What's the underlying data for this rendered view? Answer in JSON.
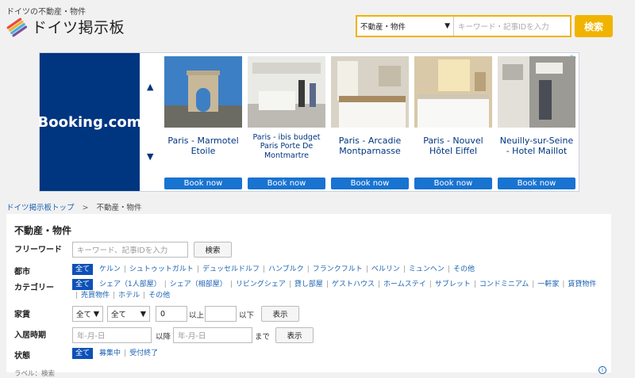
{
  "header": {
    "tagline": "ドイツの不動産・物件",
    "title": "ドイツ掲示板",
    "search": {
      "category": "不動産・物件",
      "placeholder": "キーワード・記事IDを入力",
      "button": "検索"
    }
  },
  "ad": {
    "brand": "Booking",
    "brand_suffix": ".com",
    "book_label": "Book now",
    "hotels": [
      {
        "name": "Paris - Marmotel Etoile"
      },
      {
        "name": "Paris - ibis budget Paris Porte De Montmartre"
      },
      {
        "name": "Paris - Arcadie Montparnasse"
      },
      {
        "name": "Paris - Nouvel Hôtel Eiffel"
      },
      {
        "name": "Neuilly-sur-Seine - Hotel Maillot"
      }
    ]
  },
  "breadcrumb": {
    "home": "ドイツ掲示板トップ",
    "separator": ">",
    "current": "不動産・物件"
  },
  "filters": {
    "title": "不動産・物件",
    "freeword": {
      "label": "フリーワード",
      "placeholder": "キーワード、記事IDを入力",
      "button": "検索"
    },
    "city": {
      "label": "都市",
      "options": [
        "全て",
        "ケルン",
        "シュトゥットガルト",
        "デュッセルドルフ",
        "ハンブルク",
        "フランクフルト",
        "ベルリン",
        "ミュンヘン",
        "その他"
      ]
    },
    "category": {
      "label": "カテゴリー",
      "options": [
        "全て",
        "シェア（1人部屋）",
        "シェア（相部屋）",
        "リビングシェア",
        "貸し部屋",
        "ゲストハウス",
        "ホームステイ",
        "サブレット",
        "コンドミニアム",
        "一軒家",
        "賃貸物件",
        "売買物件",
        "ホテル",
        "その他"
      ]
    },
    "rent": {
      "label": "家賃",
      "select1": "全て",
      "select2": "全て",
      "min_value": "0",
      "min_suffix": "以上",
      "max_suffix": "以下",
      "button": "表示"
    },
    "move_in": {
      "label": "入居時期",
      "from_placeholder": "年-月-日",
      "from_suffix": "以降",
      "to_placeholder": "年-月-日",
      "to_suffix": "まで",
      "button": "表示"
    },
    "status": {
      "label": "状態",
      "options": [
        "全て",
        "募集中",
        "受付終了"
      ]
    },
    "peek_text": "ラベル：検索"
  },
  "colors": {
    "accent": "#f0b400",
    "booking_blue": "#003580",
    "link": "#1a62b3",
    "active_tag": "#0d51b8"
  }
}
